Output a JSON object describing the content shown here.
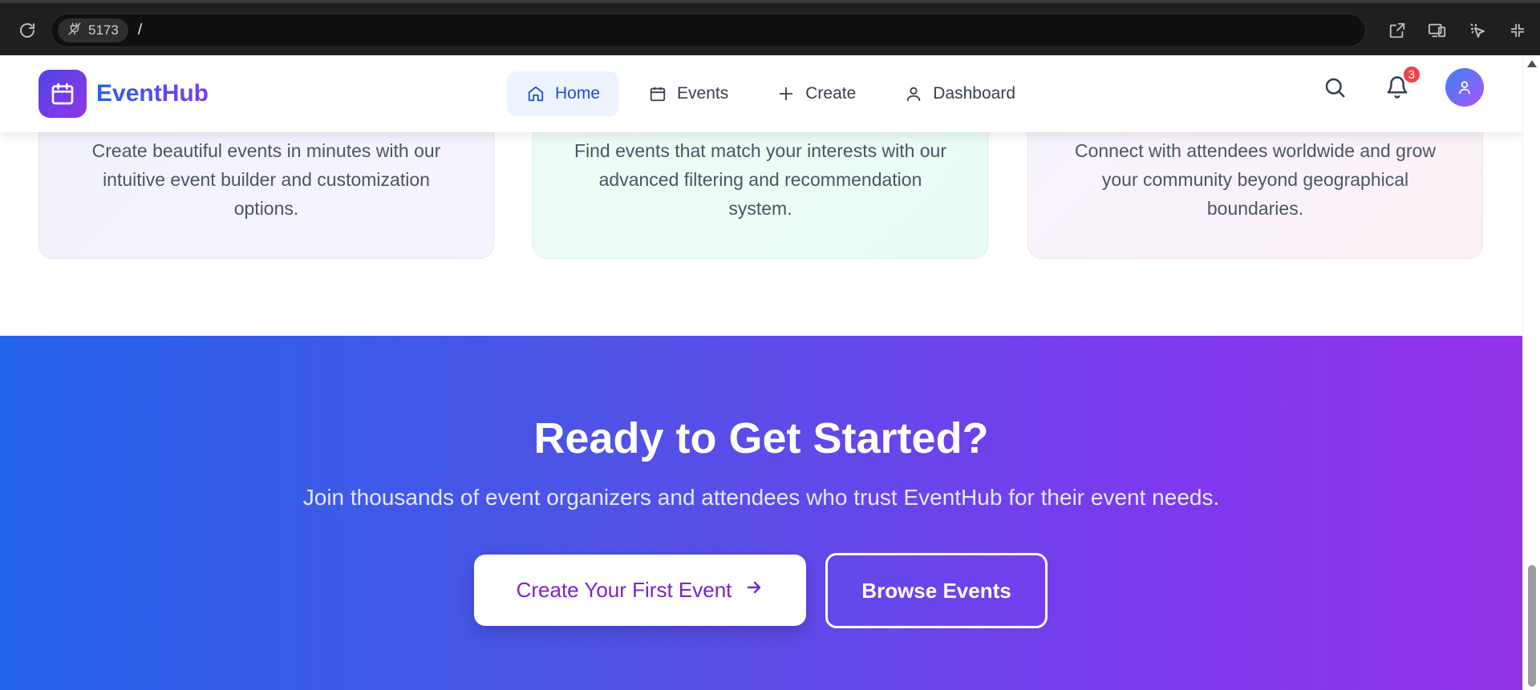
{
  "browser": {
    "port": "5173",
    "path": "/",
    "icons": [
      "reload-icon",
      "plug-off-icon",
      "open-external-icon",
      "devices-icon",
      "cursor-select-icon",
      "collapse-icon"
    ]
  },
  "header": {
    "logo_text": "EventHub",
    "nav": [
      {
        "label": "Home",
        "icon": "home-icon",
        "active": true
      },
      {
        "label": "Events",
        "icon": "calendar-icon",
        "active": false
      },
      {
        "label": "Create",
        "icon": "plus-icon",
        "active": false
      },
      {
        "label": "Dashboard",
        "icon": "user-icon",
        "active": false
      }
    ],
    "notification_count": "3"
  },
  "features": [
    {
      "description": "Create beautiful events in minutes with our intuitive event builder and customization options."
    },
    {
      "description": "Find events that match your interests with our advanced filtering and recommendation system."
    },
    {
      "description": "Connect with attendees worldwide and grow your community beyond geographical boundaries."
    }
  ],
  "cta": {
    "title": "Ready to Get Started?",
    "subtitle": "Join thousands of event organizers and attendees who trust EventHub for their event needs.",
    "primary_button": "Create Your First Event",
    "secondary_button": "Browse Events"
  },
  "colors": {
    "brand_gradient_start": "#2563eb",
    "brand_gradient_end": "#9333ea",
    "nav_active_bg": "#eef4ff",
    "nav_active_text": "#1d4ed8",
    "badge": "#ef4444",
    "primary_button_text": "#7e22ce"
  }
}
